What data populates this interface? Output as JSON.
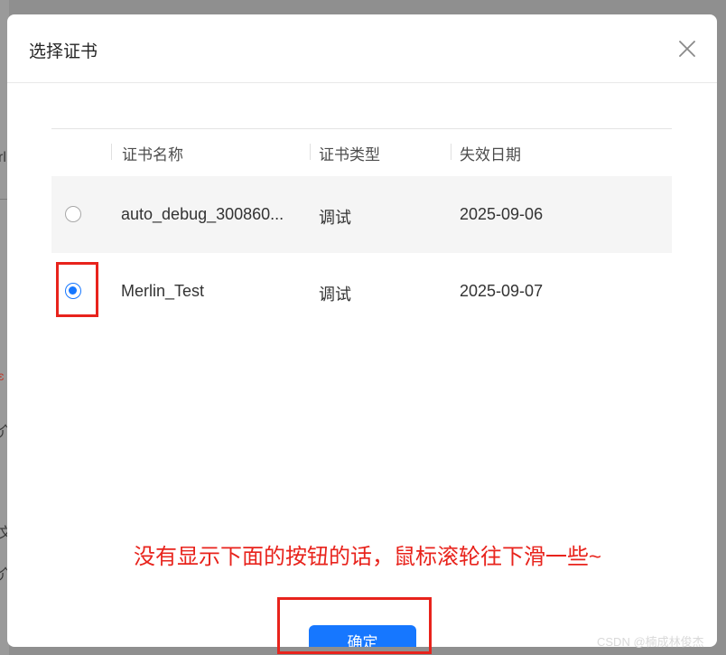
{
  "background": {
    "edge_text": [
      "rl",
      "ɛ",
      "介",
      "文",
      "介"
    ]
  },
  "dialog": {
    "title": "选择证书",
    "close_icon": "close-icon",
    "table": {
      "columns": [
        "证书名称",
        "证书类型",
        "失效日期"
      ],
      "rows": [
        {
          "name": "auto_debug_300860...",
          "type": "调试",
          "expiry": "2025-09-06",
          "selected": false
        },
        {
          "name": "Merlin_Test",
          "type": "调试",
          "expiry": "2025-09-07",
          "selected": true
        }
      ]
    },
    "confirm_label": "确定"
  },
  "annotation": {
    "text": "没有显示下面的按钮的话，鼠标滚轮往下滑一些~",
    "color": "#e8231c"
  },
  "accent_color": "#1677ff",
  "watermark": "CSDN @楠成林俊杰"
}
